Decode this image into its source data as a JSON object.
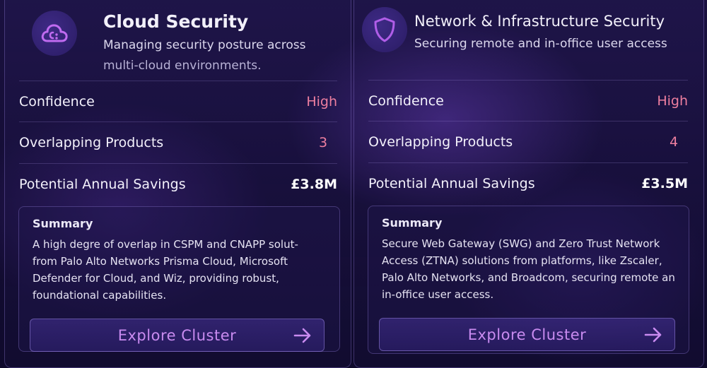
{
  "cards": [
    {
      "title": "Cloud Security",
      "subtitle_line1": "Managing security posture across",
      "subtitle_line2": "multi-cloud environments.",
      "icon": "cloud-icon",
      "rows": [
        {
          "label": "Confidence",
          "value": "High"
        },
        {
          "label": "Overlapping Products",
          "value": "3"
        },
        {
          "label": "Potential Annual Savings",
          "value": "£3.8M"
        }
      ],
      "summary_title": "Summary",
      "summary_text": "A high degre of overlap in CSPM and CNAPP solut-from Palo Alto Networks Prisma Cloud, Microsoft Defender for Cloud, and Wiz, providing robust, foundational capabilities.",
      "button_label": "Explore Cluster"
    },
    {
      "title": "Network & Infrastructure Security",
      "subtitle": "Securing remote and in-office user access",
      "icon": "shield-icon",
      "rows": [
        {
          "label": "Confidence",
          "value": "High"
        },
        {
          "label": "Overlapping Products",
          "value": "4"
        },
        {
          "label": "Potential Annual Savings",
          "value": "£3.5M"
        }
      ],
      "summary_title": "Summary",
      "summary_text": "Secure Web Gateway (SWG) and Zero Trust Network Access (ZTNA) solutions from platforms, like Zscaler, Palo Alto Networks, and Broadcom, securing remote an in-office user access.",
      "button_label": "Explore Cluster"
    }
  ],
  "colors": {
    "accent": "#c98bf0",
    "value_pink": "#ee7fa0",
    "background": "#140d35"
  }
}
